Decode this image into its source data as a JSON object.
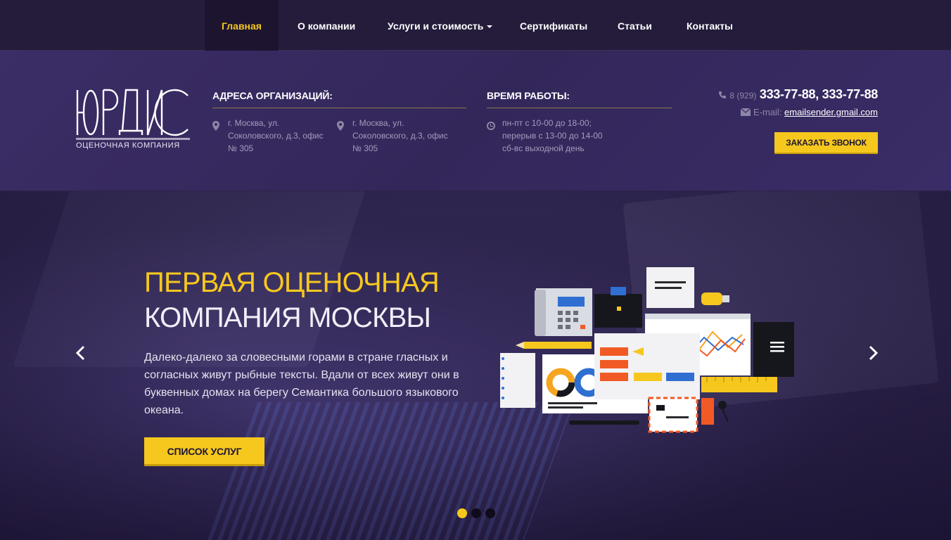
{
  "nav": {
    "items": [
      {
        "label": "Главная",
        "active": true
      },
      {
        "label": "О компании"
      },
      {
        "label": "Услуги и стоимость",
        "has_dropdown": true
      },
      {
        "label": "Сертификаты"
      },
      {
        "label": "Статьи"
      },
      {
        "label": "Контакты"
      }
    ]
  },
  "header": {
    "logo_text": "ЮРДИС",
    "logo_subtitle": "ОЦЕНОЧНАЯ КОМПАНИЯ",
    "addresses_title": "АДРЕСА ОРГАНИЗАЦИЙ:",
    "addresses": [
      "г. Москва, ул. Соколовского, д.3, офис № 305",
      "г. Москва, ул. Соколовского, д.3, офис № 305"
    ],
    "hours_title": "ВРЕМЯ РАБОТЫ:",
    "hours": [
      "пн-пт с 10-00 до 18-00;",
      "перерыв с 13-00 до 14-00",
      "сб-вс выходной день"
    ],
    "phone_prefix": "8 (929)",
    "phone_numbers": "333-77-88, 333-77-88",
    "email_label": "E-mail:",
    "email": "emailsender.gmail.com",
    "call_button": "ЗАКАЗАТЬ ЗВОНОК"
  },
  "hero": {
    "title_line1": "ПЕРВАЯ ОЦЕНОЧНАЯ",
    "title_line2": "КОМПАНИЯ МОСКВЫ",
    "text": "Далеко-далеко за словесными горами в стране гласных и согласных живут рыбные тексты. Вдали от всех живут они в буквенных домах на берегу Семантика большого языкового океана.",
    "button": "СПИСОК УСЛУГ",
    "slides_total": 3,
    "active_slide": 1
  },
  "colors": {
    "accent": "#f6c81e",
    "nav_bg": "#251c3b",
    "header_bg": "#3b2d66"
  }
}
